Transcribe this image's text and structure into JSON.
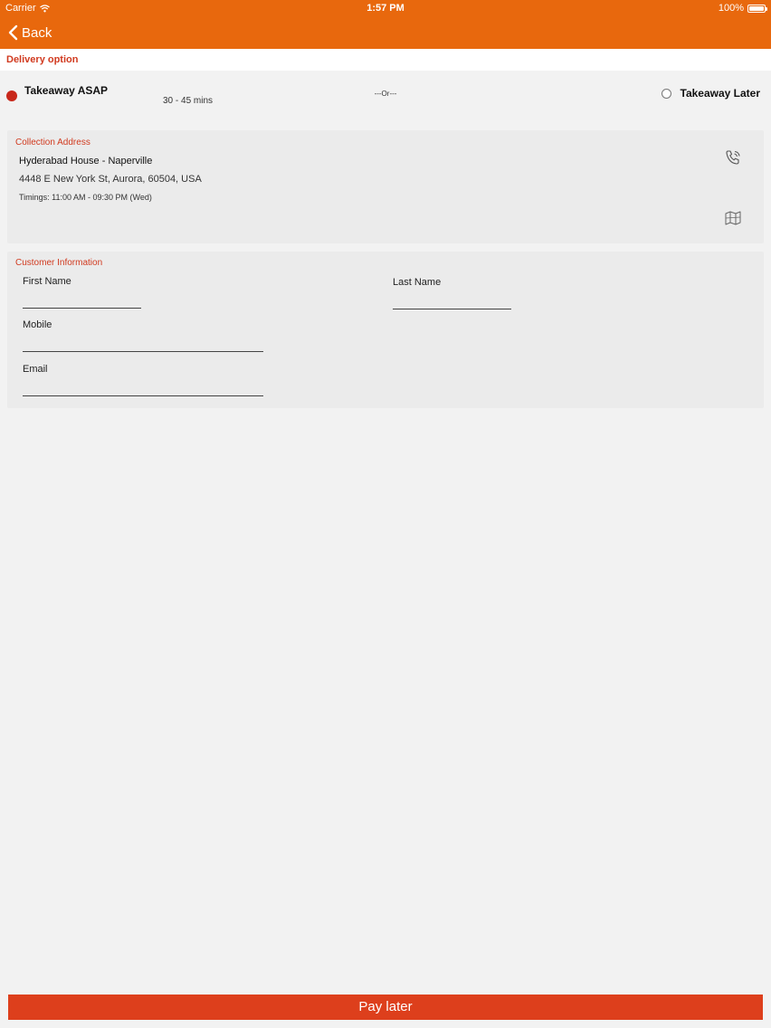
{
  "status_bar": {
    "carrier": "Carrier",
    "time": "1:57 PM",
    "battery": "100%"
  },
  "nav": {
    "back_label": "Back"
  },
  "delivery": {
    "section_label": "Delivery option",
    "asap_label": "Takeaway ASAP",
    "asap_time": "30 - 45 mins",
    "separator": "---Or---",
    "later_label": "Takeaway Later",
    "selected": "Takeaway ASAP"
  },
  "collection": {
    "label": "Collection Address",
    "name": "Hyderabad House - Naperville",
    "address": "4448 E New York St, Aurora, 60504, USA",
    "timings": "Timings: 11:00 AM - 09:30 PM (Wed)"
  },
  "customer": {
    "label": "Customer Information",
    "first_name_label": "First Name",
    "last_name_label": "Last Name",
    "mobile_label": "Mobile",
    "email_label": "Email",
    "first_name_value": "",
    "last_name_value": "",
    "mobile_value": "",
    "email_value": ""
  },
  "actions": {
    "pay_label": "Pay later"
  },
  "colors": {
    "header": "#e8680d",
    "accent_label": "#d13a1f",
    "pay_button": "#dd3f1c",
    "radio_selected": "#c8281b"
  },
  "icons": [
    "wifi-icon",
    "battery-icon",
    "chevron-left-icon",
    "phone-icon",
    "map-icon"
  ]
}
